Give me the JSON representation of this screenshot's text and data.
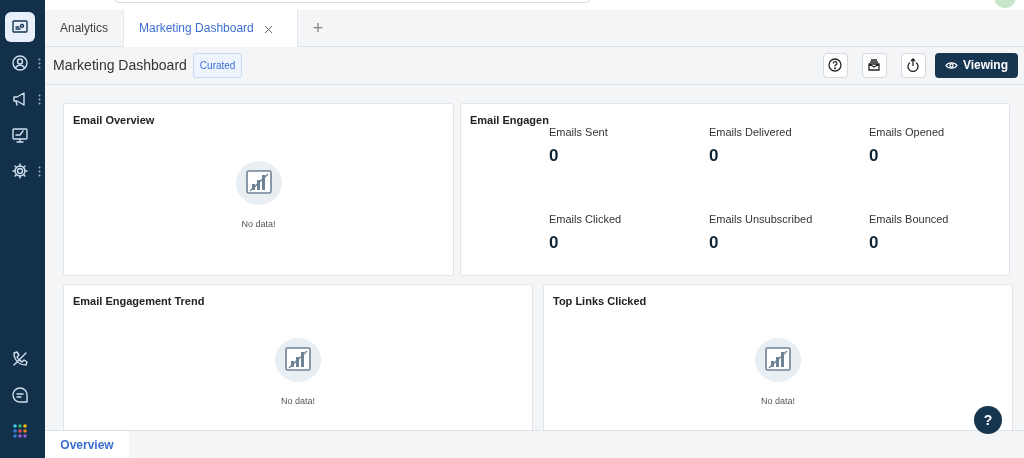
{
  "sidebar": {
    "top_items": [
      {
        "selected": true,
        "menu": false
      },
      {
        "selected": false,
        "menu": true
      },
      {
        "selected": false,
        "menu": true
      },
      {
        "selected": false,
        "menu": false
      },
      {
        "selected": false,
        "menu": true
      }
    ]
  },
  "tabs": [
    {
      "label": "Analytics",
      "selected": false,
      "closable": false
    },
    {
      "label": "Marketing Dashboard",
      "selected": true,
      "closable": true
    }
  ],
  "add_tab": "+",
  "header": {
    "title": "Marketing Dashboard",
    "badge": "Curated",
    "view_button": "Viewing"
  },
  "widgets": [
    {
      "kind": "empty",
      "title": "Email Overview",
      "message": "No data!"
    },
    {
      "kind": "stats",
      "title": "Email Engagen",
      "stats": [
        {
          "label": "Emails Sent",
          "value": "0"
        },
        {
          "label": "Emails Delivered",
          "value": "0"
        },
        {
          "label": "Emails Opened",
          "value": "0"
        },
        {
          "label": "Emails Clicked",
          "value": "0"
        },
        {
          "label": "Emails Unsubscribed",
          "value": "0"
        },
        {
          "label": "Emails Bounced",
          "value": "0"
        }
      ]
    },
    {
      "kind": "empty",
      "title": "Email Engagement Trend",
      "message": "No data!"
    },
    {
      "kind": "empty",
      "title": "Top Links Clicked",
      "message": "No data!"
    }
  ],
  "bottom_tabs": [
    {
      "label": "Overview",
      "selected": true
    }
  ],
  "help_button": "?"
}
